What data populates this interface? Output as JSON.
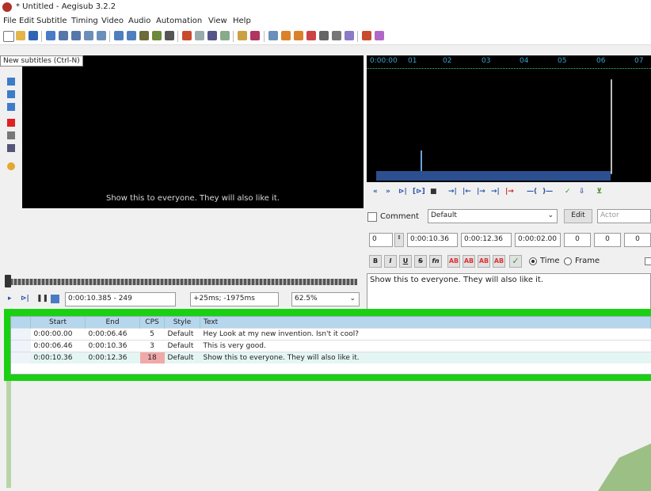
{
  "window": {
    "title": "* Untitled - Aegisub 3.2.2"
  },
  "menu": [
    "File",
    "Edit",
    "Subtitle",
    "Timing",
    "Video",
    "Audio",
    "Automation",
    "View",
    "Help"
  ],
  "tooltip": "New subtitles (Ctrl-N)",
  "video": {
    "subtitle_text": "Show this to everyone. They will also like it."
  },
  "audio": {
    "ruler_labels": [
      "0:00:00",
      "01",
      "02",
      "03",
      "04",
      "05",
      "06",
      "07"
    ]
  },
  "edit": {
    "comment_label": "Comment",
    "style": "Default",
    "edit_button": "Edit",
    "actor_placeholder": "Actor",
    "layer": "0",
    "start": "0:00:10.36",
    "end": "0:00:12.36",
    "duration": "0:00:02.00",
    "margin_l": "0",
    "margin_r": "0",
    "margin_v": "0",
    "format_buttons": [
      "B",
      "I",
      "U",
      "S",
      "fn",
      "AB",
      "AB",
      "AB",
      "AB"
    ],
    "time_label": "Time",
    "frame_label": "Frame",
    "text": "Show this to everyone. They will also like it."
  },
  "video_controls": {
    "time": "0:00:10.385 - 249",
    "offset": "+25ms; -1975ms",
    "zoom": "62.5%"
  },
  "grid": {
    "columns": [
      "Start",
      "End",
      "CPS",
      "Style",
      "Text"
    ],
    "rows": [
      {
        "start": "0:00:00.00",
        "end": "0:00:06.46",
        "cps": "5",
        "style": "Default",
        "text": "Hey Look at my new invention. Isn't it cool?"
      },
      {
        "start": "0:00:06.46",
        "end": "0:00:10.36",
        "cps": "3",
        "style": "Default",
        "text": "This is very good."
      },
      {
        "start": "0:00:10.36",
        "end": "0:00:12.36",
        "cps": "18",
        "style": "Default",
        "text": "Show this to everyone. They will also like it."
      }
    ]
  },
  "colors": {
    "highlight": "#1bd012",
    "header": "#b5d6ec",
    "cps_warning": "#f0a9a9"
  }
}
